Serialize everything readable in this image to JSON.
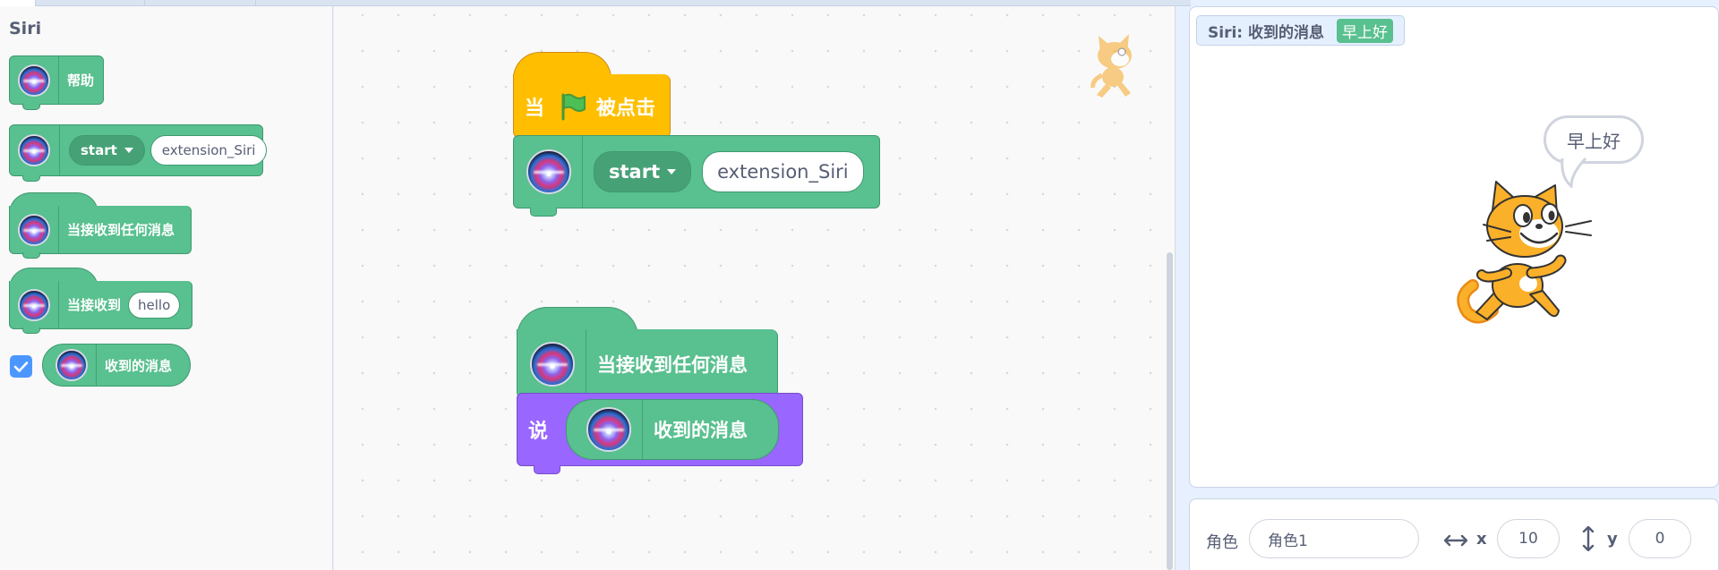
{
  "palette": {
    "category_title": "Siri",
    "blocks": {
      "help_label": "帮助",
      "start_dropdown": "start",
      "start_field": "extension_Siri",
      "when_any_message": "当接收到任何消息",
      "when_receive_label": "当接收到",
      "when_receive_field": "hello",
      "received_message": "收到的消息"
    }
  },
  "code": {
    "flag_hat_prefix": "当",
    "flag_hat_suffix": "被点击",
    "start_dropdown": "start",
    "start_field": "extension_Siri",
    "when_any_message": "当接收到任何消息",
    "say_label": "说",
    "received_message": "收到的消息"
  },
  "stage": {
    "monitor_label": "Siri: 收到的消息",
    "monitor_value": "早上好",
    "speech_bubble": "早上好"
  },
  "sprite_info": {
    "sprite_label": "角色",
    "sprite_name": "角色1",
    "x_label": "x",
    "x_value": "10",
    "y_label": "y",
    "y_value": "0"
  },
  "colors": {
    "extension_green": "#59c08f",
    "events_yellow": "#ffbf00",
    "looks_purple": "#9966ff",
    "checkbox_blue": "#4c97ff"
  }
}
